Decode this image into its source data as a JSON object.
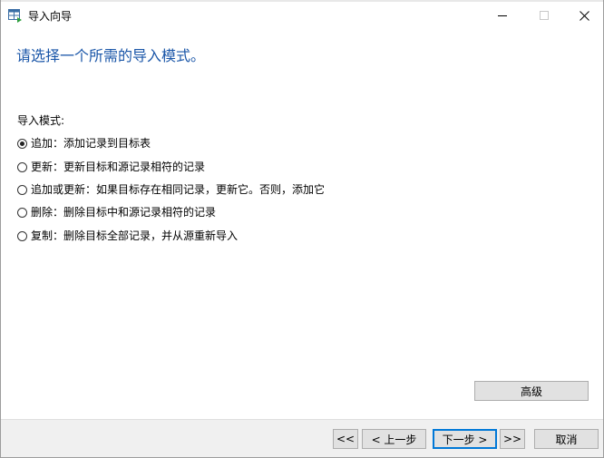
{
  "window": {
    "title": "导入向导",
    "minimize_glyph": "minimize-icon",
    "maximize_glyph": "maximize-icon",
    "close_glyph": "close-icon"
  },
  "heading": "请选择一个所需的导入模式。",
  "import_mode": {
    "label": "导入模式:",
    "selected_index": 0,
    "options": [
      {
        "label": "追加：添加记录到目标表",
        "selected": true
      },
      {
        "label": "更新：更新目标和源记录相符的记录",
        "selected": false
      },
      {
        "label": "追加或更新：如果目标存在相同记录，更新它。否则，添加它",
        "selected": false
      },
      {
        "label": "删除：删除目标中和源记录相符的记录",
        "selected": false
      },
      {
        "label": "复制：删除目标全部记录，并从源重新导入",
        "selected": false
      }
    ]
  },
  "advanced_button": "高级",
  "footer": {
    "first_label": "<<",
    "prev_label": "< 上一步",
    "next_label": "下一步 >",
    "last_label": ">>",
    "cancel_label": "取消"
  },
  "colors": {
    "heading": "#1a56a8",
    "footer_bg": "#f0f0f0",
    "button_bg": "#e1e1e1",
    "default_button_border": "#0078d7"
  }
}
